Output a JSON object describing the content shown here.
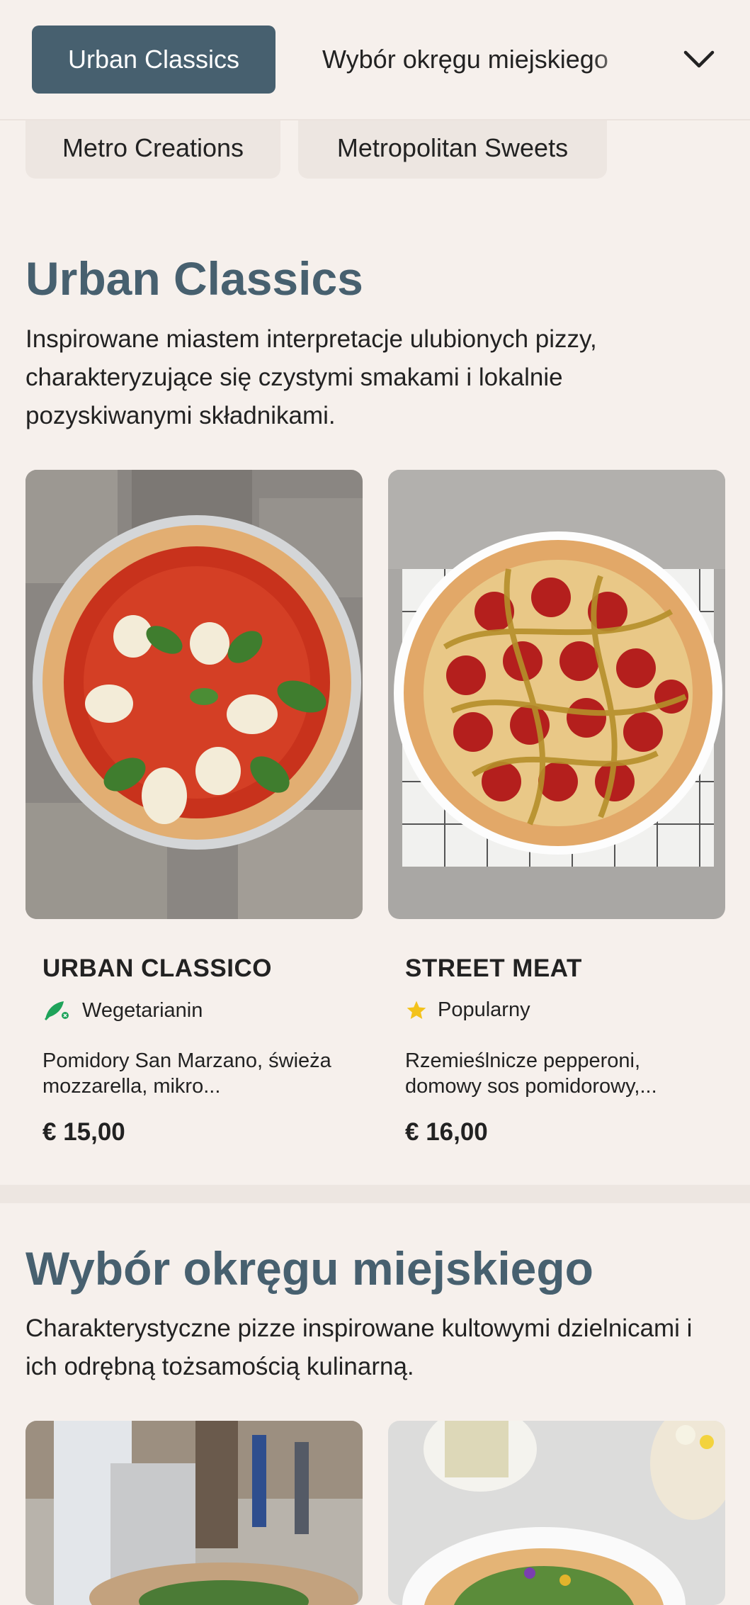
{
  "nav": {
    "active_tab": "Urban Classics",
    "next_tab": "Wybór okręgu miejskiego",
    "chevron_icon": "chevron-down-icon"
  },
  "subnav": {
    "items": [
      "Metro Creations",
      "Metropolitan Sweets"
    ]
  },
  "sections": [
    {
      "title": "Urban Classics",
      "description": "Inspirowane miastem interpretacje ulubionych pizzy, charakteryzujące się czystymi smakami i lokalnie pozyskiwanymi składnikami.",
      "items": [
        {
          "name": "URBAN CLASSICO",
          "tag": "Wegetarianin",
          "tag_icon": "vegetarian-icon",
          "tag_color": "#1fa35a",
          "description": "Pomidory San Marzano, świeża mozzarella, mikro...",
          "price": "€ 15,00"
        },
        {
          "name": "STREET MEAT",
          "tag": "Popularny",
          "tag_icon": "star-icon",
          "tag_color": "#f3c21b",
          "description": "Rzemieślnicze pepperoni, domowy sos pomidorowy,...",
          "price": "€ 16,00"
        }
      ]
    },
    {
      "title": "Wybór okręgu miejskiego",
      "description": "Charakterystyczne pizze inspirowane kultowymi dzielnicami i ich odrębną tożsamością kulinarną."
    }
  ],
  "colors": {
    "accent": "#47606f",
    "background": "#f6f0ec",
    "pill": "#ede6e1"
  }
}
